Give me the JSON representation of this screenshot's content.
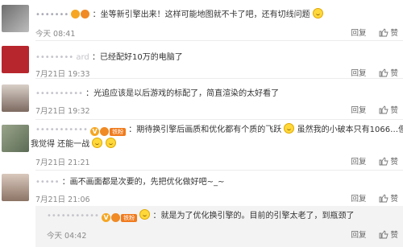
{
  "comments": [
    {
      "username": "•••••••",
      "text": "：坐等新引擎出来！这样可能地图就不卡了吧，还有切线问题",
      "time": "今天 08:41",
      "reply": "回复",
      "like": "赞"
    },
    {
      "username": "•••••••• ard",
      "text": "：已经配好10万的电脑了",
      "time": "7月21日 19:33",
      "reply": "回复",
      "like": "赞"
    },
    {
      "username": "••••••••••",
      "text": "：光追应该是以后游戏的标配了，简直渲染的太好看了",
      "time": "7月21日 19:32",
      "reply": "回复",
      "like": "赞"
    },
    {
      "username": "•••••••••••",
      "badge_rank": "铁粉",
      "text_a": "：期待换引擎后画质和优化都有个质的飞跃",
      "text_b": "虽然我的小破本只有1066…但",
      "text_c": "我觉得 还能一战",
      "time": "7月21日 21:21",
      "reply": "回复",
      "like": "赞"
    },
    {
      "username": "•••••",
      "text": "：画不画面都是次要的，先把优化做好吧~_~",
      "time": "7月21日 21:06",
      "reply": "回复",
      "like": "赞"
    },
    {
      "username": "•••••••••••",
      "badge_rank": "铁粉",
      "text": "：就是为了优化换引擎的。目前的引擎太老了，到瓶颈了",
      "time": "今天 04:42",
      "reply": "回复",
      "like": "赞"
    }
  ]
}
